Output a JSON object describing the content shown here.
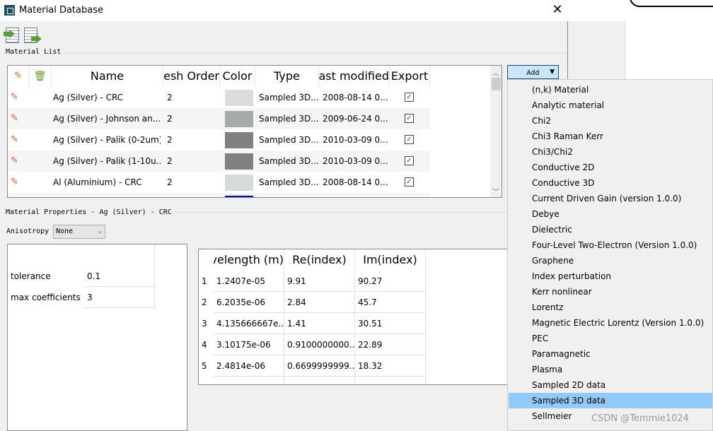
{
  "window": {
    "title": "Material Database",
    "close_label": "✕"
  },
  "material_list": {
    "label": "Material List",
    "columns": [
      "",
      "",
      "Name",
      "Mesh Order",
      "Color",
      "Type",
      "Last modified",
      "Export"
    ],
    "rows": [
      {
        "name": "Ag (Silver) - CRC",
        "mesh_order": "2",
        "color": "#dcdcdc",
        "type": "Sampled 3D...",
        "modified": "2008-08-14 0...",
        "export": true
      },
      {
        "name": "Ag (Silver) - Johnson an...",
        "mesh_order": "2",
        "color": "#a6aaa8",
        "type": "Sampled 3D...",
        "modified": "2009-06-24 0...",
        "export": true
      },
      {
        "name": "Ag (Silver) - Palik (0-2um)",
        "mesh_order": "2",
        "color": "#808080",
        "type": "Sampled 3D...",
        "modified": "2010-03-09 0...",
        "export": true
      },
      {
        "name": "Ag (Silver) - Palik (1-10u...",
        "mesh_order": "2",
        "color": "#808080",
        "type": "Sampled 3D...",
        "modified": "2010-03-09 0...",
        "export": true
      },
      {
        "name": "Al (Aluminium) - CRC",
        "mesh_order": "2",
        "color": "#d3dcd6",
        "type": "Sampled 3D...",
        "modified": "2008-08-14 0...",
        "export": true
      },
      {
        "name": "",
        "mesh_order": "",
        "color": "#0000ff",
        "type": "",
        "modified": "",
        "export": false
      }
    ]
  },
  "add_button": {
    "label": "Add"
  },
  "add_menu": {
    "items": [
      "(n,k) Material",
      "Analytic material",
      "Chi2",
      "Chi3 Raman Kerr",
      "Chi3/Chi2",
      "Conductive 2D",
      "Conductive 3D",
      "Current Driven Gain (version 1.0.0)",
      "Debye",
      "Dielectric",
      "Four-Level Two-Electron (Version 1.0.0)",
      "Graphene",
      "Index perturbation",
      "Kerr nonlinear",
      "Lorentz",
      "Magnetic Electric Lorentz (Version 1.0.0)",
      "PEC",
      "Paramagnetic",
      "Plasma",
      "Sampled 2D data",
      "Sampled 3D data",
      "Sellmeier"
    ],
    "selected": "Sampled 3D data",
    "highlight_color": "#91c9f7"
  },
  "properties": {
    "label": "Material Properties - Ag (Silver) - CRC",
    "anisotropy_label": "Anisotropy",
    "anisotropy_value": "None",
    "params": [
      {
        "label": "tolerance",
        "value": "0.1"
      },
      {
        "label": "max coefficients",
        "value": "3"
      }
    ]
  },
  "data_table": {
    "columns": [
      "Wavelength (m)",
      "Re(index)",
      "Im(index)"
    ],
    "rows": [
      {
        "n": "1",
        "wl": "1.2407e-05",
        "re": "9.91",
        "im": "90.27"
      },
      {
        "n": "2",
        "wl": "6.2035e-06",
        "re": "2.84",
        "im": "45.7"
      },
      {
        "n": "3",
        "wl": "4.135666667e...",
        "re": "1.41",
        "im": "30.51"
      },
      {
        "n": "4",
        "wl": "3.10175e-06",
        "re": "0.9100000000...",
        "im": "22.89"
      },
      {
        "n": "5",
        "wl": "2.4814e-06",
        "re": "0.6699999999...",
        "im": "18.32"
      }
    ]
  },
  "watermark": "CSDN @Temmie1024"
}
